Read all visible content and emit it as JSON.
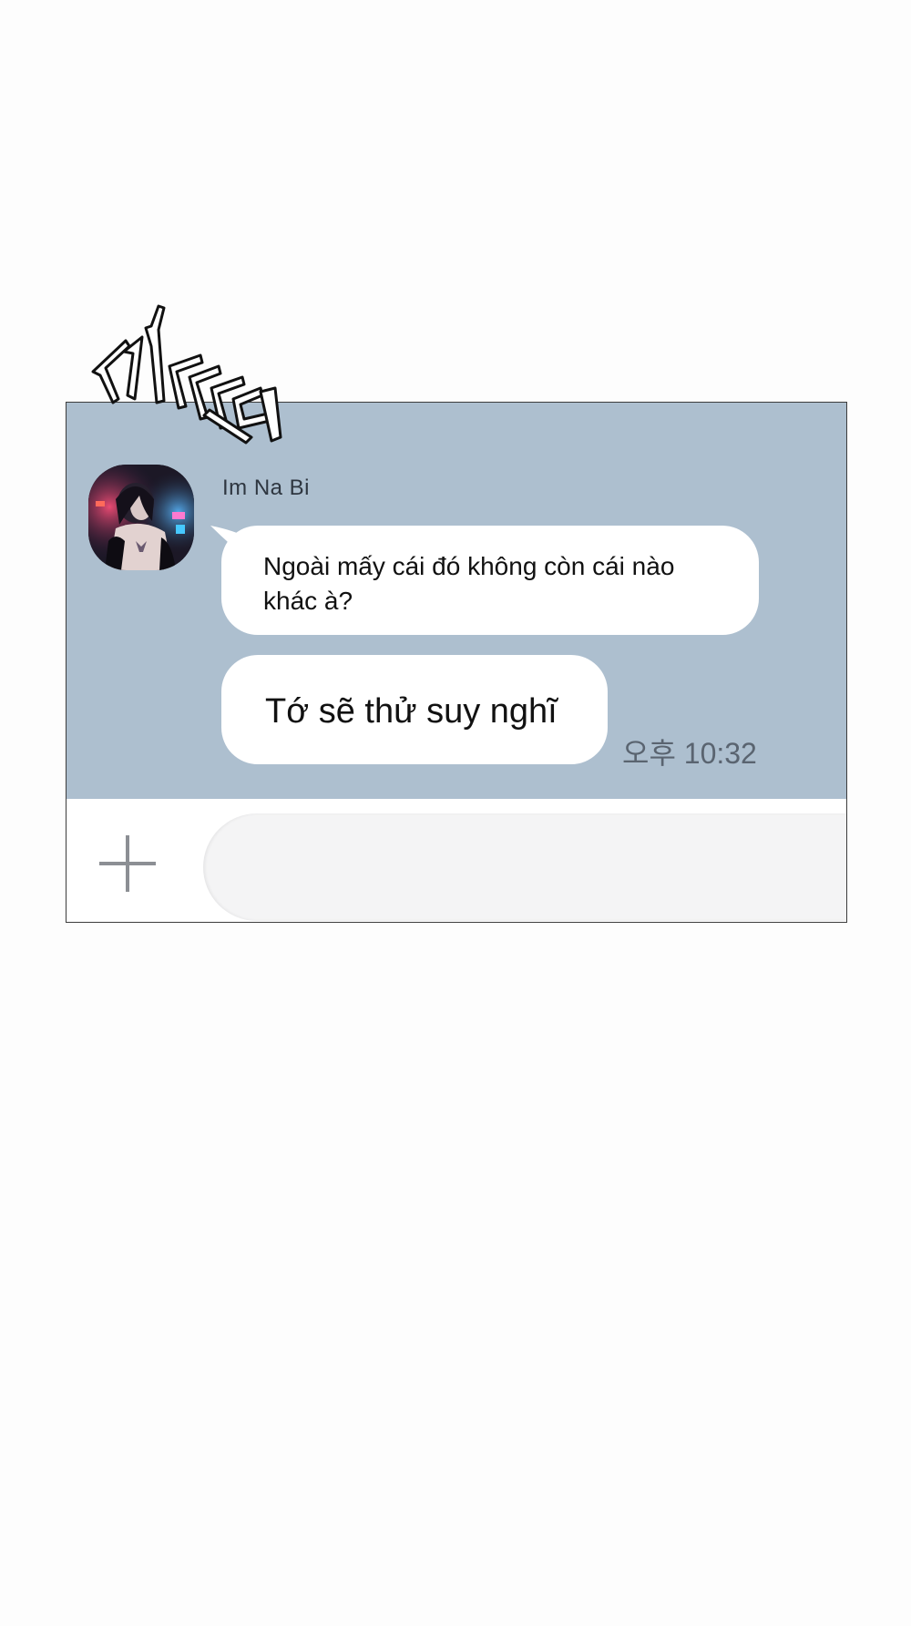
{
  "sound_effect": {
    "text": "까똑"
  },
  "chat": {
    "contact": {
      "name": "Im Na Bi",
      "avatar_icon": "profile-photo"
    },
    "messages": [
      {
        "text": "Ngoài mấy cái đó không còn cái nào khác à?"
      },
      {
        "text": "Tớ sẽ thử suy nghĩ"
      }
    ],
    "timestamp": "오후 10:32"
  },
  "input_bar": {
    "add_icon": "plus-icon",
    "message_value": "",
    "message_placeholder": ""
  },
  "colors": {
    "chat_background": "#adbfcf",
    "bubble": "#ffffff",
    "input_field": "#f4f4f5",
    "page": "#fdfdfd"
  }
}
